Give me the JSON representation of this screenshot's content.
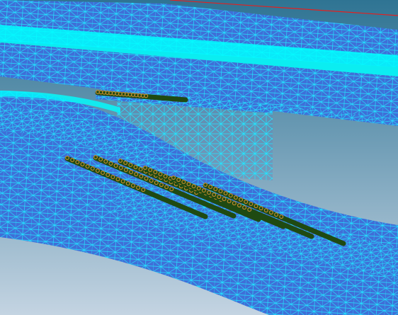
{
  "scene": {
    "kind": "fea-mesh-viewport",
    "background_colors": {
      "top": "#2f7493",
      "middle": "#6f9db6",
      "bottom": "#c4d4e2"
    },
    "mesh": {
      "fill_color": "#3f6fd8",
      "line_color": "#22e6ff",
      "edge_highlight_color": "#00ffff"
    },
    "rebar": {
      "bar_color": "#1f4a12",
      "end_ring_color": "#c08a2c",
      "upper_bar_count": 1,
      "lower_bar_count": 6
    },
    "axis_line_color": "#e32020",
    "icons": [
      "wireframe-mesh",
      "rebar-bundle",
      "axis-line"
    ]
  }
}
